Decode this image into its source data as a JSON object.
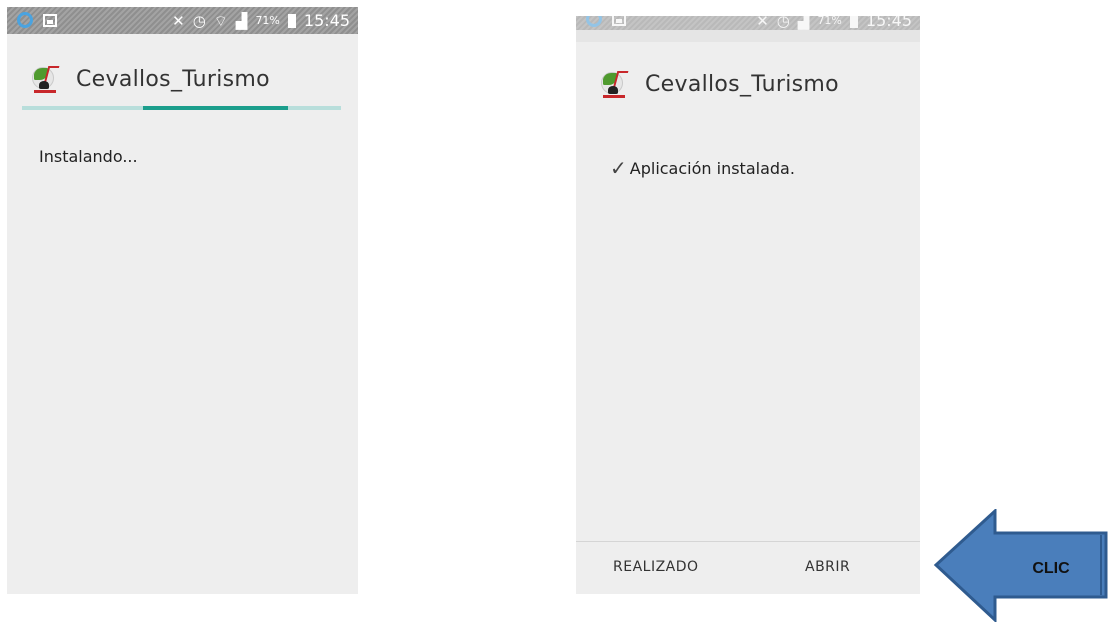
{
  "status_bar": {
    "icons": [
      "circle-notification-icon",
      "image-icon",
      "mute-icon",
      "alarm-icon",
      "wifi-icon",
      "signal-icon",
      "battery-icon"
    ],
    "battery_percent": "71%",
    "time": "15:45"
  },
  "app": {
    "name": "Cevallos_Turismo",
    "logo_icon": "cevallos-logo-icon"
  },
  "screen_installing": {
    "progress": 0.48,
    "progress_color": "#1b9e8c",
    "track_color": "#b8dedb",
    "message": "Instalando..."
  },
  "screen_installed": {
    "message": "Aplicación instalada.",
    "check_icon": "check-icon",
    "buttons": {
      "done": "REALIZADO",
      "open": "ABRIR"
    }
  },
  "annotation": {
    "arrow_label": "CLIC",
    "arrow_fill": "#4a7ebb",
    "arrow_stroke": "#2f5b8f"
  }
}
